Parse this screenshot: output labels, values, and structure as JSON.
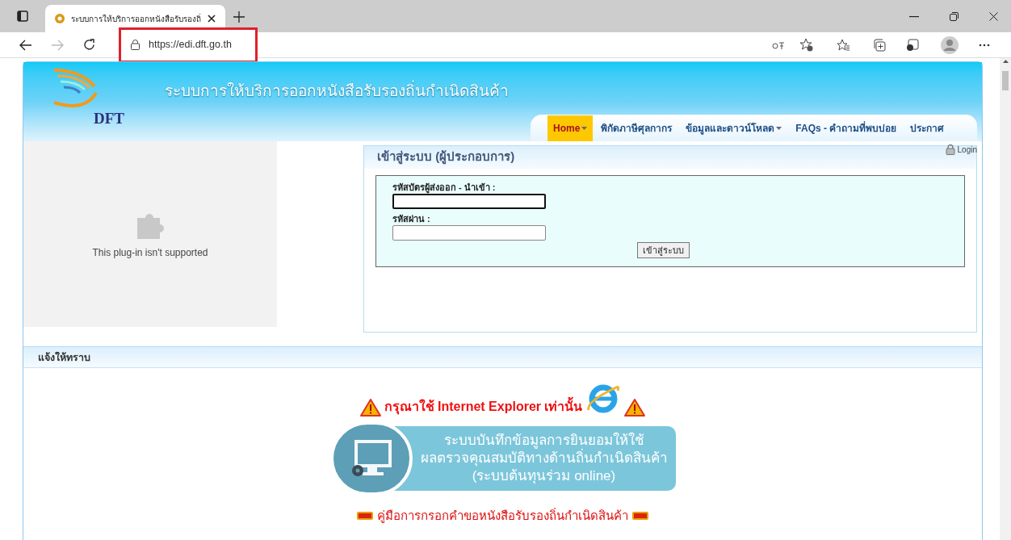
{
  "browser": {
    "tab_title": "ระบบการให้บริการออกหนังสือรับรองถิ่",
    "url": "https://edi.dft.go.th"
  },
  "site": {
    "title": "ระบบการให้บริการออกหนังสือรับรองถิ่นกำเนิดสินค้า",
    "logo_text": "DFT",
    "nav": [
      {
        "label": "Home",
        "selected": true,
        "dropdown": true
      },
      {
        "label": "พิกัดภาษีศุลกากร",
        "selected": false,
        "dropdown": false
      },
      {
        "label": "ข้อมูลและดาวน์โหลด",
        "selected": false,
        "dropdown": true
      },
      {
        "label": "FAQs - คำถามที่พบบ่อย",
        "selected": false,
        "dropdown": false
      },
      {
        "label": "ประกาศ",
        "selected": false,
        "dropdown": false
      }
    ],
    "login_link": "Login",
    "plugin_message": "This plug-in isn't supported",
    "login_panel": {
      "title": "เข้าสู่ระบบ (ผู้ประกอบการ)",
      "fields": [
        {
          "label": "รหัสบัตรผู้ส่งออก - นำเข้า :",
          "focused": true
        },
        {
          "label": "รหัสผ่าน :",
          "focused": false
        }
      ],
      "button": "เข้าสู่ระบบ"
    },
    "notice": {
      "title": "แจ้งให้ทราบ",
      "warning": "กรุณาใช้ **Internet Explorer** เท่านั้น",
      "banner_lines": [
        "ระบบบันทึกข้อมูลการยินยอมให้ใช้",
        "ผลตรวจคุณสมบัติทางด้านถิ่นกำเนิดสินค้า",
        "(ระบบต้นทุนร่วม online)"
      ],
      "manual_link": "คู่มือการกรอกคำขอหนังสือรับรองถิ่นกำเนิดสินค้า"
    }
  }
}
